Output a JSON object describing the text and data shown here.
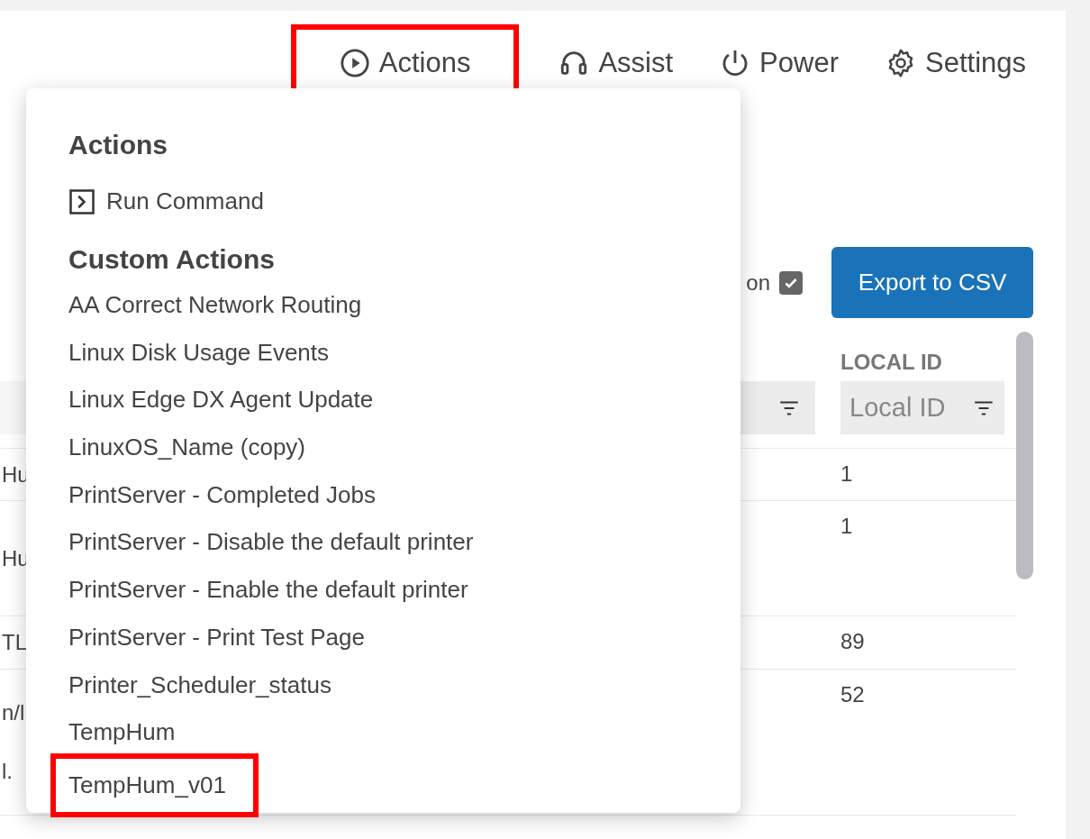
{
  "toolbar": [
    {
      "kind": "actions",
      "label": "Actions",
      "highlighted": true
    },
    {
      "kind": "assist",
      "label": "Assist",
      "highlighted": false
    },
    {
      "kind": "power",
      "label": "Power",
      "highlighted": false
    },
    {
      "kind": "settings",
      "label": "Settings",
      "highlighted": false
    }
  ],
  "option": {
    "label": "on",
    "checked": true
  },
  "export_button": "Export to CSV",
  "table": {
    "column_2": {
      "header": "LOCAL ID",
      "placeholder": "Local ID"
    },
    "rows": [
      {
        "column_1": [
          "Hu"
        ],
        "column_2": "1"
      },
      {
        "column_1": [
          "Hu"
        ],
        "column_2": "1"
      },
      {
        "column_1": [
          "TL"
        ],
        "column_2": "89"
      },
      {
        "column_1": [
          "n/l",
          "l."
        ],
        "column_2": "52"
      }
    ]
  },
  "dropdown": {
    "title": "Actions",
    "run_command": "Run Command",
    "section": "Custom Actions",
    "items": [
      {
        "label": "AA Correct Network Routing",
        "highlighted": false
      },
      {
        "label": "Linux Disk Usage Events",
        "highlighted": false
      },
      {
        "label": "Linux Edge DX Agent Update",
        "highlighted": false
      },
      {
        "label": "LinuxOS_Name (copy)",
        "highlighted": false
      },
      {
        "label": "PrintServer - Completed Jobs",
        "highlighted": false
      },
      {
        "label": "PrintServer - Disable the default printer",
        "highlighted": false
      },
      {
        "label": "PrintServer - Enable the default printer",
        "highlighted": false
      },
      {
        "label": "PrintServer - Print Test Page",
        "highlighted": false
      },
      {
        "label": "Printer_Scheduler_status",
        "highlighted": false
      },
      {
        "label": "TempHum",
        "highlighted": false
      },
      {
        "label": "TempHum_v01",
        "highlighted": true
      }
    ]
  }
}
